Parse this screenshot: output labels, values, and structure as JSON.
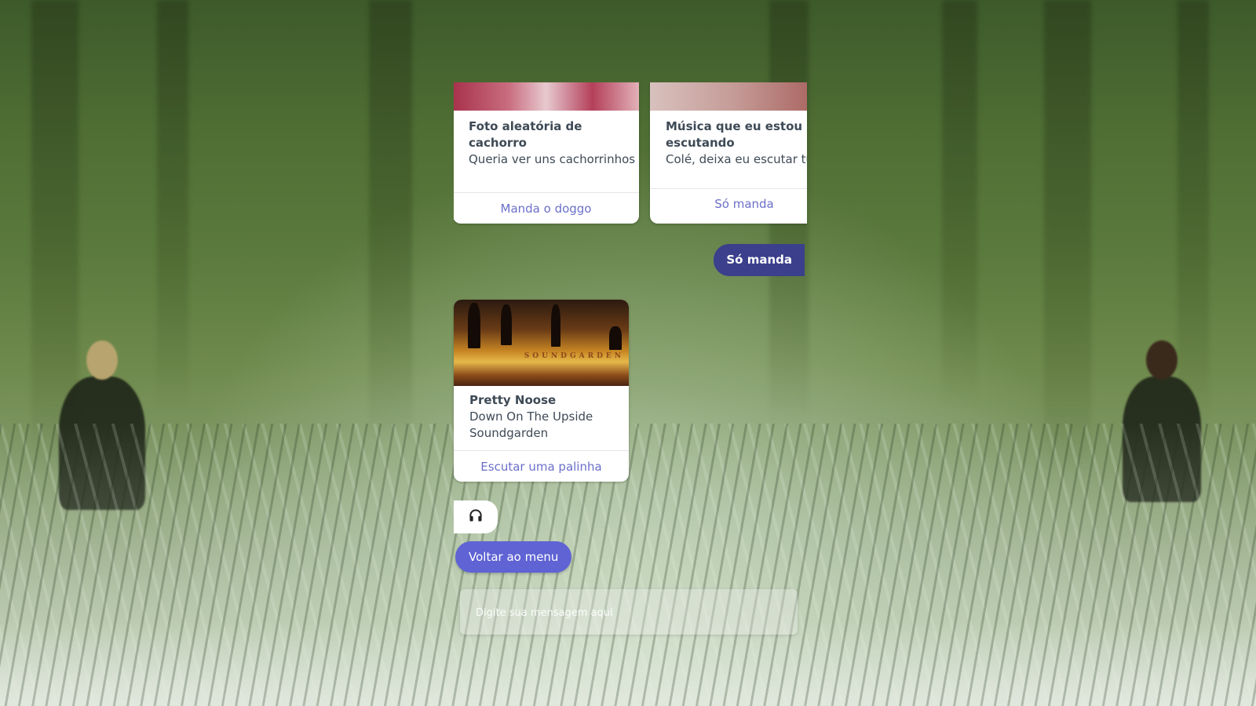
{
  "carousel": {
    "cards": [
      {
        "title": "Foto aleatória de cachorro",
        "subtitle": "Queria ver uns cachorrinhos",
        "action": "Manda o doggo"
      },
      {
        "title": "Música que eu estou escutando",
        "subtitle": "Colé, deixa eu escutar tu",
        "action": "Só manda"
      }
    ]
  },
  "user_message": "Só manda",
  "song": {
    "title": "Pretty Noose",
    "album": "Down On The Upside",
    "artist": "Soundgarden",
    "band_logo": "SOUNDGARDEN",
    "action": "Escutar uma palinha"
  },
  "icon_bubble": {
    "icon": "headphones-icon"
  },
  "menu_button": "Voltar ao menu",
  "composer": {
    "placeholder": "Digite sua mensagem aqui"
  },
  "colors": {
    "user_bubble": "#3b3f8c",
    "quick_reply": "#5f63d4",
    "card_action": "#6b6fc9",
    "card_text": "#3e4a56"
  }
}
